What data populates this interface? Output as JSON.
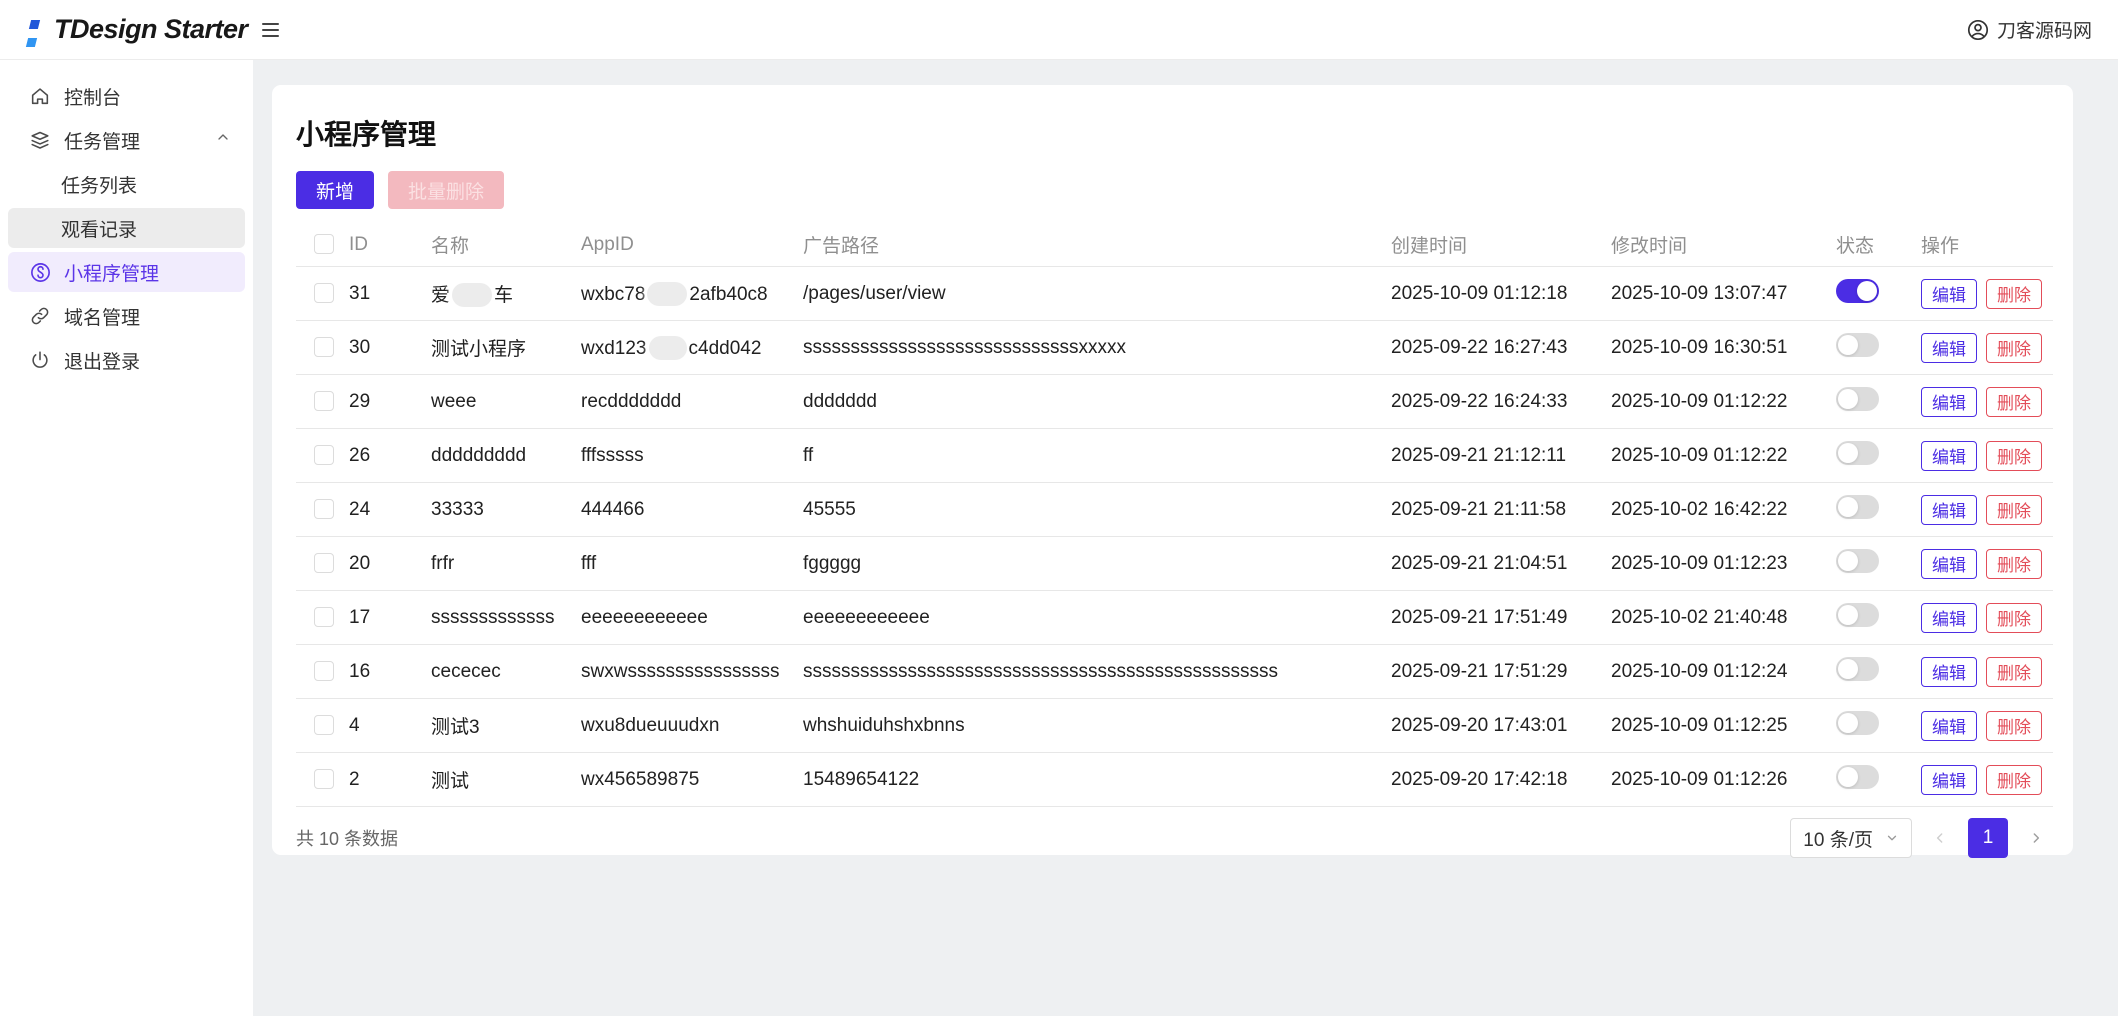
{
  "colors": {
    "brand": "#4b2de4",
    "brand_light": "#f1ecfd",
    "danger": "#e34d59"
  },
  "header": {
    "logo_text": "TDesign Starter",
    "user_name": "刀客源码网"
  },
  "sidebar": {
    "items": [
      {
        "label": "控制台",
        "icon": "home"
      },
      {
        "label": "任务管理",
        "icon": "layers",
        "expanded": true
      },
      {
        "label": "任务列表"
      },
      {
        "label": "观看记录",
        "hovered": true
      },
      {
        "label": "小程序管理",
        "icon": "miniprogram",
        "active": true
      },
      {
        "label": "域名管理",
        "icon": "link"
      },
      {
        "label": "退出登录",
        "icon": "power"
      }
    ]
  },
  "main": {
    "title": "小程序管理",
    "toolbar": {
      "add_label": "新增",
      "batch_delete_label": "批量删除"
    },
    "table": {
      "columns": [
        "ID",
        "名称",
        "AppID",
        "广告路径",
        "创建时间",
        "修改时间",
        "状态",
        "操作"
      ],
      "action_labels": {
        "edit": "编辑",
        "delete": "删除"
      },
      "rows": [
        {
          "id": "31",
          "name": [
            {
              "t": "爱"
            },
            {
              "blur": 40
            },
            {
              "t": "车"
            }
          ],
          "appid": [
            {
              "t": "wxbc78"
            },
            {
              "blur": 40
            },
            {
              "t": "2afb40c8"
            }
          ],
          "path": "/pages/user/view",
          "created": "2025-10-09 01:12:18",
          "modified": "2025-10-09 13:07:47",
          "status": true
        },
        {
          "id": "30",
          "name": "测试小程序",
          "appid": [
            {
              "t": "wxd123"
            },
            {
              "blur": 38
            },
            {
              "t": "c4dd042"
            }
          ],
          "path": "sssssssssssssssssssssssssssssxxxxx",
          "created": "2025-09-22 16:27:43",
          "modified": "2025-10-09 16:30:51",
          "status": false
        },
        {
          "id": "29",
          "name": "weee",
          "appid": "recddddddd",
          "path": "ddddddd",
          "created": "2025-09-22 16:24:33",
          "modified": "2025-10-09 01:12:22",
          "status": false
        },
        {
          "id": "26",
          "name": "ddddddddd",
          "appid": "fffsssss",
          "path": "ff",
          "created": "2025-09-21 21:12:11",
          "modified": "2025-10-09 01:12:22",
          "status": false
        },
        {
          "id": "24",
          "name": "33333",
          "appid": "444466",
          "path": "45555",
          "created": "2025-09-21 21:11:58",
          "modified": "2025-10-02 16:42:22",
          "status": false
        },
        {
          "id": "20",
          "name": "frfr",
          "appid": "fff",
          "path": "fggggg",
          "created": "2025-09-21 21:04:51",
          "modified": "2025-10-09 01:12:23",
          "status": false
        },
        {
          "id": "17",
          "name": "sssssssssssss",
          "appid": "eeeeeeeeeeee",
          "path": "eeeeeeeeeeee",
          "created": "2025-09-21 17:51:49",
          "modified": "2025-10-02 21:40:48",
          "status": false
        },
        {
          "id": "16",
          "name": "cececec",
          "appid": "swxwssssssssssssssss",
          "path": "ssssssssssssssssssssssssssssssssssssssssssssssssss",
          "created": "2025-09-21 17:51:29",
          "modified": "2025-10-09 01:12:24",
          "status": false
        },
        {
          "id": "4",
          "name": "测试3",
          "appid": "wxu8dueuuudxn",
          "path": "whshuiduhshxbnns",
          "created": "2025-09-20 17:43:01",
          "modified": "2025-10-09 01:12:25",
          "status": false
        },
        {
          "id": "2",
          "name": "测试",
          "appid": "wx456589875",
          "path": "15489654122",
          "created": "2025-09-20 17:42:18",
          "modified": "2025-10-09 01:12:26",
          "status": false
        }
      ]
    },
    "footer": {
      "total_text": "共 10 条数据",
      "page_size_label": "10 条/页",
      "current_page": "1"
    }
  }
}
